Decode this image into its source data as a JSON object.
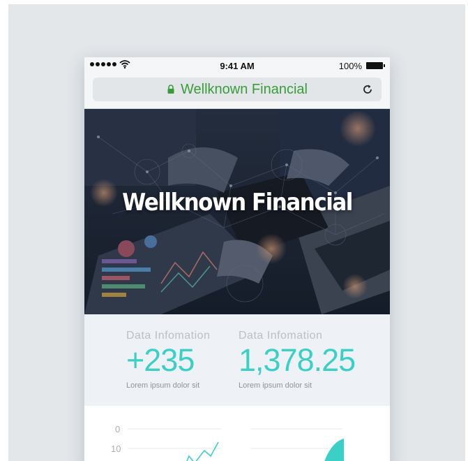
{
  "status_bar": {
    "time": "9:41 AM",
    "battery_label": "100%"
  },
  "browser": {
    "url_title": "Wellknown Financial",
    "lock_icon": "lock-icon",
    "reload_icon": "reload-icon"
  },
  "hero": {
    "title": "Wellknown Financial"
  },
  "stats": [
    {
      "label": "Data Infomation",
      "value": "+235",
      "caption": "Lorem ipsum dolor sit"
    },
    {
      "label": "Data Infomation",
      "value": "1,378.25",
      "caption": "Lorem ipsum dolor sit"
    }
  ],
  "charts": {
    "ticks": [
      "0",
      "10"
    ],
    "accent_color": "#3bd0c5"
  }
}
